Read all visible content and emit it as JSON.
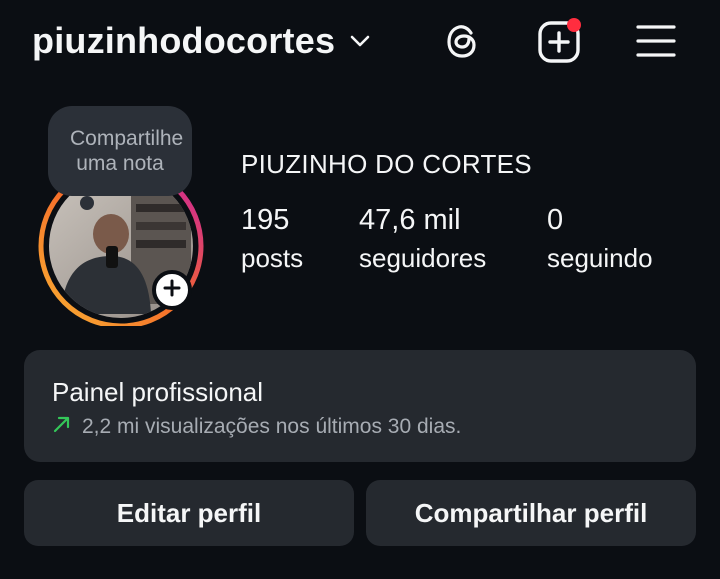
{
  "header": {
    "username": "piuzinhodocortes",
    "icons": [
      "chevron-down-icon",
      "threads-icon",
      "add-post-icon",
      "menu-icon"
    ],
    "notification_color": "#ff2d3f"
  },
  "note": {
    "text": "Compartilhe uma nota"
  },
  "profile": {
    "display_name": "PIUZINHO DO CORTES",
    "stats": {
      "posts": {
        "value": "195",
        "label": "posts"
      },
      "followers": {
        "value": "47,6 mil",
        "label": "seguidores"
      },
      "following": {
        "value": "0",
        "label": "seguindo"
      }
    }
  },
  "professional_panel": {
    "title": "Painel profissional",
    "subtitle": "2,2 mi visualizações nos últimos 30 dias.",
    "trend_color": "#34c759"
  },
  "actions": {
    "edit_label": "Editar perfil",
    "share_label": "Compartilhar perfil"
  },
  "colors": {
    "background": "#0b0e13",
    "card": "#25292f",
    "story_ring_start": "#f9b233",
    "story_ring_end": "#c81da6"
  }
}
